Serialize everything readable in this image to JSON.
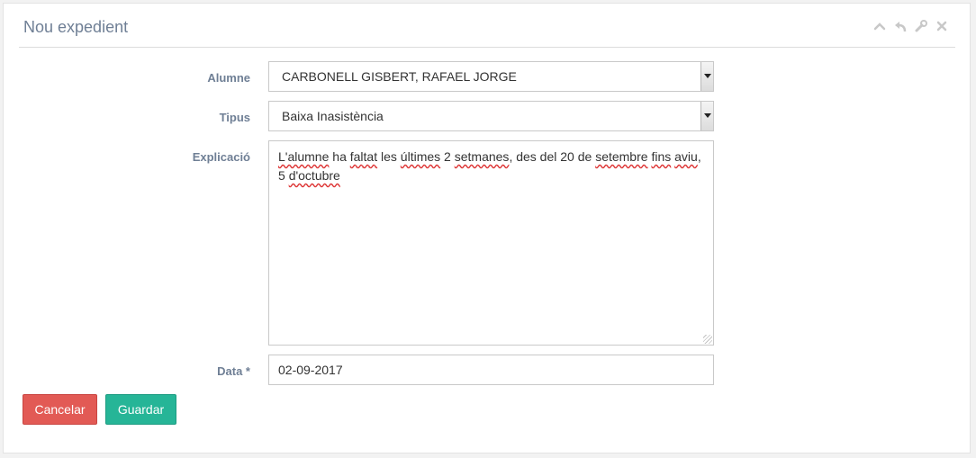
{
  "header": {
    "title": "Nou expedient"
  },
  "form": {
    "alumne": {
      "label": "Alumne",
      "value": "CARBONELL GISBERT, RAFAEL JORGE"
    },
    "tipus": {
      "label": "Tipus",
      "value": "Baixa Inasistència"
    },
    "explicacio": {
      "label": "Explicació",
      "words": [
        "L'alumne",
        " ha ",
        "faltat",
        " les ",
        "últimes",
        " 2 ",
        "setmanes",
        ", des del 20 de ",
        "setembre",
        " ",
        "fins",
        " ",
        "aviu",
        ", 5 ",
        "d'octubre"
      ]
    },
    "data": {
      "label": "Data *",
      "value": "02-09-2017"
    }
  },
  "buttons": {
    "cancel": "Cancelar",
    "save": "Guardar"
  },
  "colors": {
    "cancel": "#e25a55",
    "save": "#26b597",
    "label": "#6f7f95"
  },
  "icons": {
    "toolbar": [
      "chevron-up-icon",
      "reply-icon",
      "wrench-icon",
      "close-icon"
    ]
  }
}
